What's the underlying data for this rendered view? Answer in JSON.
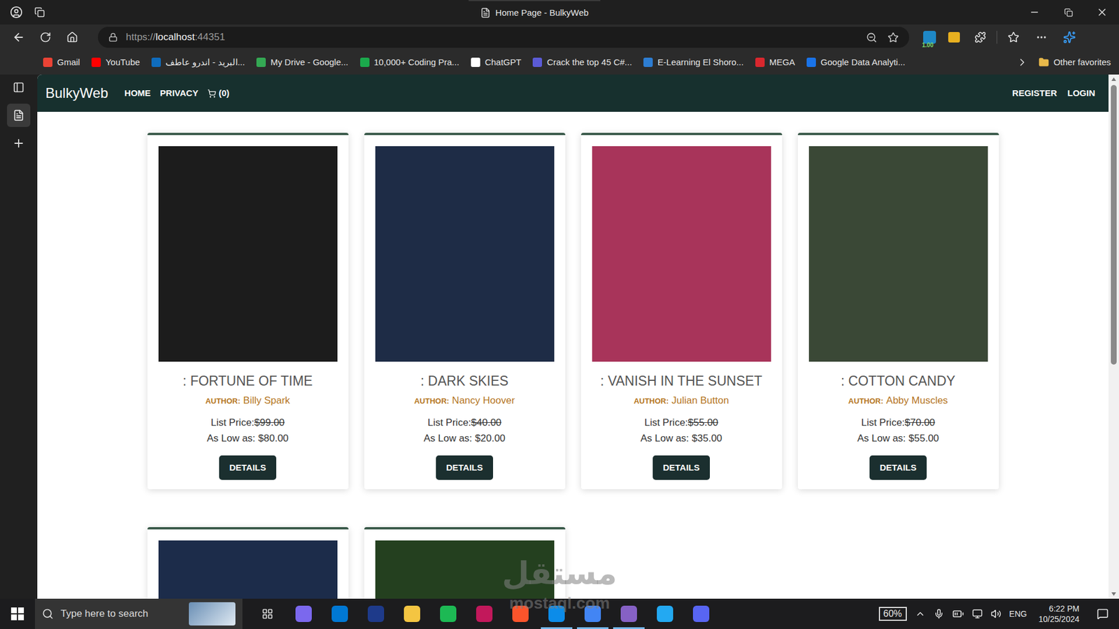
{
  "window": {
    "title": "Home Page - BulkyWeb"
  },
  "browser": {
    "url_scheme": "https://",
    "url_host": "localhost",
    "url_port": ":44351",
    "extension_badge": "1.00",
    "favorites": [
      {
        "label": "Gmail",
        "color": "#ea4335"
      },
      {
        "label": "YouTube",
        "color": "#ff0000"
      },
      {
        "label": "البريد - اندرو عاطف...",
        "color": "#0f6cbd"
      },
      {
        "label": "My Drive - Google...",
        "color": "#34a853"
      },
      {
        "label": "10,000+ Coding Pra...",
        "color": "#1ba94c"
      },
      {
        "label": "ChatGPT",
        "color": "#ffffff"
      },
      {
        "label": "Crack the top 45 C#...",
        "color": "#5b5bd6"
      },
      {
        "label": "E-Learning El Shoro...",
        "color": "#2d7dd2"
      },
      {
        "label": "MEGA",
        "color": "#d9272e"
      },
      {
        "label": "Google Data Analyti...",
        "color": "#1a73e8"
      }
    ],
    "other_favorites": "Other favorites"
  },
  "site": {
    "brand": "BulkyWeb",
    "nav": [
      "HOME",
      "PRIVACY"
    ],
    "cart": "(0)",
    "auth": [
      "REGISTER",
      "LOGIN"
    ]
  },
  "products": [
    {
      "title": ": FORTUNE OF TIME",
      "author_label": "AUTHOR:",
      "author": "Billy Spark",
      "list_price_label": "List Price:",
      "list_price": "$99.00",
      "low_label": "As Low as:",
      "low_price": "$80.00",
      "button": "DETAILS",
      "color": "#1c1c1c"
    },
    {
      "title": ": DARK SKIES",
      "author_label": "AUTHOR:",
      "author": "Nancy Hoover",
      "list_price_label": "List Price:",
      "list_price": "$40.00",
      "low_label": "As Low as:",
      "low_price": "$20.00",
      "button": "DETAILS",
      "color": "#1e2c46"
    },
    {
      "title": ": VANISH IN THE SUNSET",
      "author_label": "AUTHOR:",
      "author": "Julian Button",
      "list_price_label": "List Price:",
      "list_price": "$55.00",
      "low_label": "As Low as:",
      "low_price": "$35.00",
      "button": "DETAILS",
      "color": "#a8345a"
    },
    {
      "title": ": COTTON CANDY",
      "author_label": "AUTHOR:",
      "author": "Abby Muscles",
      "list_price_label": "List Price:",
      "list_price": "$70.00",
      "low_label": "As Low as:",
      "low_price": "$55.00",
      "button": "DETAILS",
      "color": "#3a4836"
    }
  ],
  "partial_products": [
    {
      "color": "#1c2c4a"
    },
    {
      "color": "#24401f"
    }
  ],
  "watermark": {
    "arabic": "مستقل",
    "latin": "mostaql.com"
  },
  "taskbar": {
    "search_placeholder": "Type here to search",
    "apps": [
      {
        "color": "#7b68ee",
        "active": false
      },
      {
        "color": "#0078d4",
        "active": false
      },
      {
        "color": "#1e3a8a",
        "active": false
      },
      {
        "color": "#f4c542",
        "active": false
      },
      {
        "color": "#1db954",
        "active": false
      },
      {
        "color": "#c2185b",
        "active": false
      },
      {
        "color": "#fb542b",
        "active": false
      },
      {
        "color": "#0c8ce9",
        "active": true
      },
      {
        "color": "#4285f4",
        "active": true
      },
      {
        "color": "#8661c5",
        "active": true
      },
      {
        "color": "#23a9f2",
        "active": false
      },
      {
        "color": "#5865f2",
        "active": false
      }
    ],
    "battery": "60%",
    "language": "ENG",
    "time": "6:22 PM",
    "date": "10/25/2024"
  }
}
